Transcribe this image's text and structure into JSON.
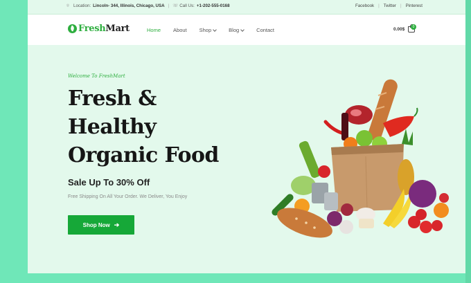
{
  "topbar": {
    "location_label": "Location:",
    "location_value": "Lincoln- 344, Illinois, Chicago, USA",
    "call_label": "Call Us:",
    "call_value": "+1-202-555-0168",
    "socials": [
      "Facebook",
      "Twitter",
      "Pinterest"
    ]
  },
  "header": {
    "logo_part1": "Fresh",
    "logo_part2": "Mart",
    "nav": [
      {
        "label": "Home",
        "active": true
      },
      {
        "label": "About"
      },
      {
        "label": "Shop"
      },
      {
        "label": "Blog"
      },
      {
        "label": "Contact"
      }
    ],
    "cart_total": "0.00$",
    "cart_count": "0"
  },
  "hero": {
    "eyebrow": "Welcome To FreshMart",
    "title_lines": [
      "Fresh &",
      "Healthy",
      "Organic Food"
    ],
    "subtitle": "Sale Up To 30% Off",
    "description": "Free Shipping On All Your Order. We Deliver, You Enjoy",
    "cta_label": "Shop Now"
  },
  "colors": {
    "brand_green": "#16a838",
    "page_bg": "#e3f9ec",
    "outer_bg": "#6fe7b8"
  },
  "icons": [
    "location-icon",
    "phone-icon",
    "logo-leaf-icon",
    "chevron-down-icon",
    "cart-icon",
    "arrow-right-icon"
  ]
}
